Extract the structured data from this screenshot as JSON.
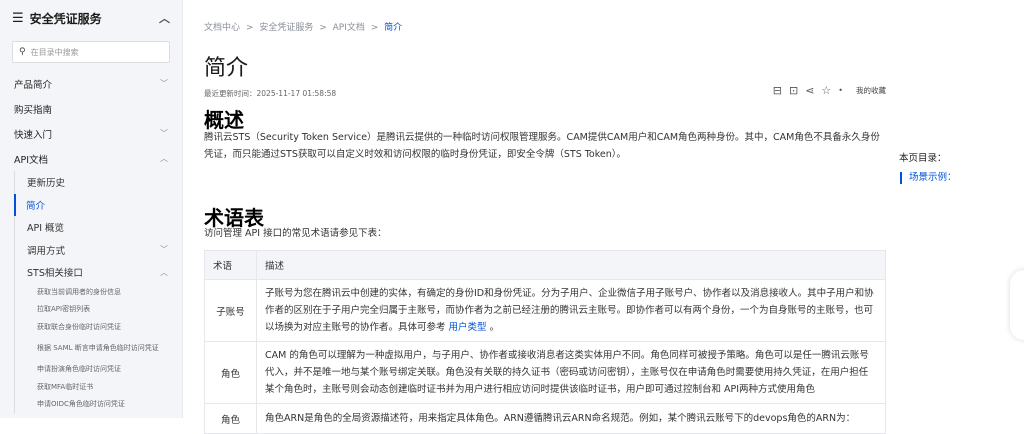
{
  "sidebar": {
    "title": "安全凭证服务",
    "search_placeholder": "在目录中搜索",
    "items": [
      {
        "label": "产品简介",
        "chevron": "⌄"
      },
      {
        "label": "购买指南",
        "chevron": ""
      },
      {
        "label": "快速入门",
        "chevron": "⌄"
      },
      {
        "label": "API文档",
        "chevron": "⌃"
      }
    ],
    "api_sub": [
      {
        "label": "更新历史",
        "chevron": ""
      },
      {
        "label": "简介",
        "chevron": ""
      },
      {
        "label": "API 概览",
        "chevron": ""
      },
      {
        "label": "调用方式",
        "chevron": "⌄"
      },
      {
        "label": "STS相关接口",
        "chevron": "⌃"
      }
    ],
    "sts_sub": [
      "获取当前调用者的身份信息",
      "拉取API密钥列表",
      "获取联合身份临时访问凭证",
      "根据 SAML 断言申请角色临时访问凭证",
      "申请扮演角色临时访问凭证",
      "获取MFA临时证书",
      "申请OIDC角色临时访问凭证"
    ]
  },
  "breadcrumb": {
    "items": [
      "文档中心",
      "安全凭证服务",
      "API文档",
      "简介"
    ],
    "separator": ">"
  },
  "page": {
    "title": "简介",
    "updated": "最近更新时间：2025-11-17 01:58:58",
    "favorite": "我的收藏",
    "overview_heading": "概述",
    "overview_text": "腾讯云STS（Security Token Service）是腾讯云提供的一种临时访问权限管理服务。CAM提供CAM用户和CAM角色两种身份。其中，CAM角色不具备永久身份凭证，而只能通过STS获取可以自定义时效和访问权限的临时身份凭证，即安全令牌（STS Token）。",
    "terms_heading": "术语表",
    "terms_intro": "访问管理 API 接口的常见术语请参见下表：",
    "table": {
      "headers": [
        "术语",
        "描述"
      ],
      "rows": [
        {
          "term": "子账号",
          "desc": "子账号为您在腾讯云中创建的实体，有确定的身份ID和身份凭证。分为子用户、企业微信子用子账号户、协作者以及消息接收人。其中子用户和协作者的区别在于子用户完全归属于主账号，而协作者为之前已经注册的腾讯云主账号。即协作者可以有两个身份，一个为自身账号的主账号，也可以场换为对应主账号的协作者。具体可参考 ",
          "link": "用户类型",
          "suffix": " 。"
        },
        {
          "term": "角色",
          "desc": "CAM 的角色可以理解为一种虚拟用户，与子用户、协作者或接收消息者这类实体用户不同。角色同样可被授予策略。角色可以是任一腾讯云账号代入，并不是唯一地与某个账号绑定关联。角色没有关联的持久证书（密码或访问密钥），主账号仅在申请角色时需要使用持久凭证，在用户担任某个角色时，主账号则会动态创建临时证书并为用户进行相应访问时提供该临时证书，用户即可通过控制台和 API两种方式使用角色",
          "link": "",
          "suffix": ""
        },
        {
          "term": "角色",
          "desc": "角色ARN是角色的全局资源描述符，用来指定具体角色。ARN遵循腾讯云ARN命名规范。例如，某个腾讯云账号下的devops角色的ARN为：",
          "link": "",
          "suffix": ""
        }
      ]
    }
  },
  "toc": {
    "title": "本页目录：",
    "items": [
      "场景示例："
    ]
  },
  "icons": {
    "menu": "menu-icon",
    "collapse": "chevron-up-icon",
    "search": "search-icon",
    "toolbar": [
      "print-icon",
      "download-icon",
      "share-icon",
      "star-icon",
      "more-icon"
    ]
  },
  "colors": {
    "accent": "#0052d9",
    "sidebar_bg": "#f4f5f8"
  }
}
